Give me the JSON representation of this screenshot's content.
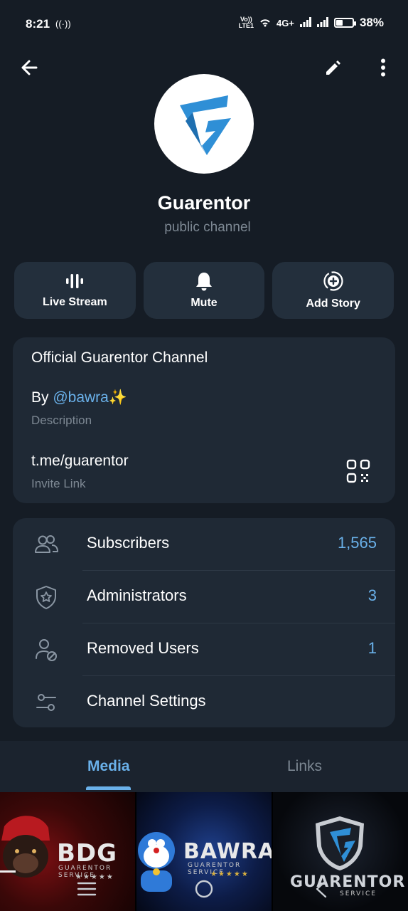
{
  "status_bar": {
    "time": "8:21",
    "hotspot_icon": "((·))",
    "volte": "VoLTE1",
    "network": "4G+",
    "battery": "38%"
  },
  "top_bar": {
    "back_icon": "arrow-left",
    "edit_icon": "pencil",
    "more_icon": "vertical-dots"
  },
  "profile": {
    "title": "Guarentor",
    "subtitle": "public channel"
  },
  "actions": [
    {
      "label": "Live Stream",
      "icon": "live-stream"
    },
    {
      "label": "Mute",
      "icon": "bell"
    },
    {
      "label": "Add Story",
      "icon": "add-story"
    }
  ],
  "info": {
    "description_text": "Official Guarentor Channel",
    "by_prefix": "By ",
    "by_handle": "@bawra",
    "by_emoji": "✨",
    "description_label": "Description",
    "link": "t.me/guarentor",
    "link_label": "Invite Link"
  },
  "manage": [
    {
      "label": "Subscribers",
      "count": "1,565",
      "icon": "users"
    },
    {
      "label": "Administrators",
      "count": "3",
      "icon": "shield-star"
    },
    {
      "label": "Removed Users",
      "count": "1",
      "icon": "user-blocked"
    },
    {
      "label": "Channel Settings",
      "count": "",
      "icon": "sliders"
    }
  ],
  "tabs": [
    {
      "label": "Media",
      "active": true
    },
    {
      "label": "Links",
      "active": false
    }
  ],
  "media": [
    {
      "brand": "BDG",
      "sub": "GUARENTOR SERVICE"
    },
    {
      "brand": "BAWRA",
      "sub": "GUARENTOR SERVICE"
    },
    {
      "brand": "GUARENTOR",
      "sub": "SERVICE"
    }
  ],
  "colors": {
    "background": "#151c25",
    "card": "#1f2935",
    "accent": "#6ab1ea",
    "muted": "#7d8893"
  }
}
